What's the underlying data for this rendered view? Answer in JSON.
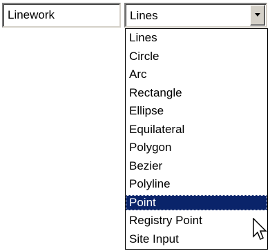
{
  "layer_field": {
    "value": "Linework"
  },
  "type_combo": {
    "value": "Lines",
    "items": [
      {
        "label": "Lines",
        "selected": false
      },
      {
        "label": "Circle",
        "selected": false
      },
      {
        "label": "Arc",
        "selected": false
      },
      {
        "label": "Rectangle",
        "selected": false
      },
      {
        "label": "Ellipse",
        "selected": false
      },
      {
        "label": "Equilateral",
        "selected": false
      },
      {
        "label": "Polygon",
        "selected": false
      },
      {
        "label": "Bezier",
        "selected": false
      },
      {
        "label": "Polyline",
        "selected": false
      },
      {
        "label": "Point",
        "selected": true
      },
      {
        "label": "Registry Point",
        "selected": false
      },
      {
        "label": "Site Input",
        "selected": false
      }
    ],
    "dropdown_icon": "chevron-down-icon"
  },
  "colors": {
    "selection_background": "#0a246a",
    "selection_text": "#ffffff",
    "button_face": "#d4d0c8"
  },
  "cursor": {
    "icon": "arrow-cursor-icon"
  }
}
